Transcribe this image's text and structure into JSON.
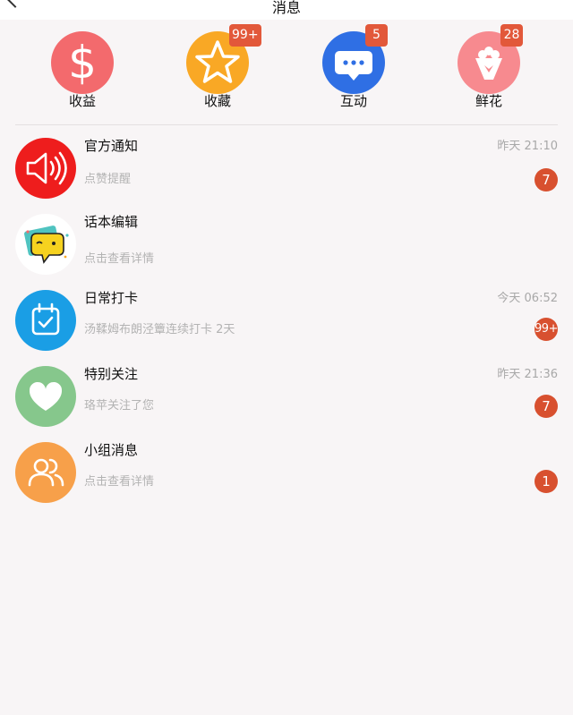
{
  "header": {
    "title": "消息"
  },
  "categories": [
    {
      "label": "收益",
      "icon": "dollar-icon",
      "color": "#f36a6d",
      "badge": ""
    },
    {
      "label": "收藏",
      "icon": "star-icon",
      "color": "#f9a825",
      "badge": "99+"
    },
    {
      "label": "互动",
      "icon": "chat-bubble-icon",
      "color": "#2f6fe4",
      "badge": "5"
    },
    {
      "label": "鲜花",
      "icon": "bouquet-icon",
      "color": "#f78a8f",
      "badge": "28"
    }
  ],
  "messages": [
    {
      "name": "官方通知",
      "time": "昨天 21:10",
      "preview": "点赞提醒",
      "count": "7",
      "icon": "speaker-icon",
      "color": "#ee1d1d"
    },
    {
      "name": "话本编辑",
      "time": "",
      "preview": "点击查看详情",
      "count": "",
      "icon": "chat-mascot-icon",
      "color": "#ffffff"
    },
    {
      "name": "日常打卡",
      "time": "今天 06:52",
      "preview": "汤鞣姆布朗泾簟连续打卡 2天",
      "count": "99+",
      "icon": "calendar-check-icon",
      "color": "#1a9ee5"
    },
    {
      "name": "特别关注",
      "time": "昨天 21:36",
      "preview": "珞苹关注了您",
      "count": "7",
      "icon": "heart-icon",
      "color": "#86c78c"
    },
    {
      "name": "小组消息",
      "time": "",
      "preview": "点击查看详情",
      "count": "1",
      "icon": "group-icon",
      "color": "#f7a04a"
    }
  ]
}
